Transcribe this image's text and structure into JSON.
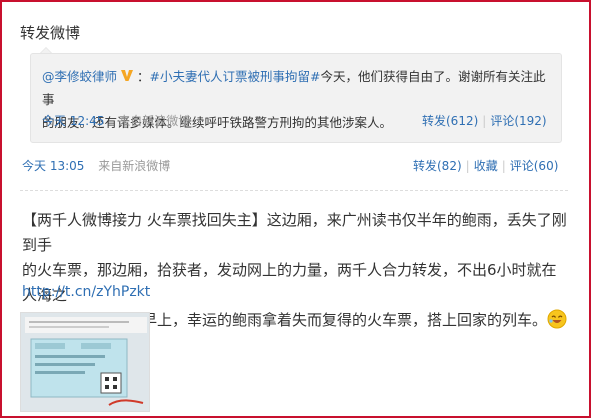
{
  "section_title": "转发微博",
  "quote": {
    "author": "@李修蛟律师",
    "author_suffix": "：",
    "hashtag": "#小夫妻代人订票被刑事拘留#",
    "text_line1_rest": "今天，他们获得自由了。谢谢所有关注此事",
    "text_line2": "的朋友。还有诸多媒体。继续呼吁铁路警方刑拘的其他涉案人。",
    "time": "今天 12:45",
    "source": "来自新浪微博",
    "repost": "转发(612)",
    "comment": "评论(192)"
  },
  "status": {
    "time": "今天 13:05",
    "source": "来自新浪微博",
    "repost": "转发(82)",
    "favorite": "收藏",
    "comment": "评论(60)"
  },
  "post": {
    "line1": "【两千人微博接力 火车票找回失主】这边厢，来广州读书仅半年的鲍雨，丢失了刚到手",
    "line2": "的火车票，那边厢，拾获者，发动网上的力量，两千人合力转发，不出6小时就在人海之",
    "line3": "中找到了他。今天早上，幸运的鲍雨拿着失而复得的火车票，搭上回家的列车。",
    "url": "http://t.cn/zYhPzkt"
  },
  "icons": {
    "verified": "verified-v-icon",
    "emoji": "laughing-face-emoji-icon"
  },
  "colors": {
    "link": "#2f6fb3",
    "frame": "#c8102e",
    "verified": "#f5a623"
  }
}
